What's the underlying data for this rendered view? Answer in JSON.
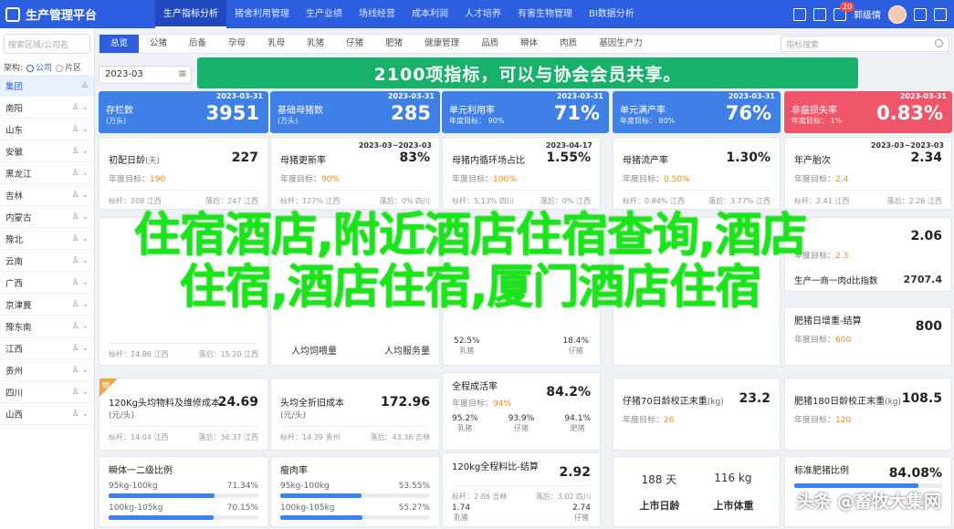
{
  "app": {
    "title": "生产管理平台"
  },
  "topnav": [
    "生产指标分析",
    "猪舍利用管理",
    "生产业绩",
    "场线经营",
    "成本利润",
    "人才培养",
    "有害生物管理",
    "BI数据分析"
  ],
  "topright": {
    "badge": "20",
    "user": "郭级情"
  },
  "sidebar": {
    "search_placeholder": "搜索区域/公司名",
    "scope_label": "架构:",
    "scope_options": [
      "公司",
      "片区"
    ],
    "items": [
      "集团",
      "南阳",
      "山东",
      "安徽",
      "黑龙江",
      "吉林",
      "内蒙古",
      "豫北",
      "云南",
      "广西",
      "京津冀",
      "豫东南",
      "江西",
      "贵州",
      "四川",
      "山西"
    ]
  },
  "tabs": [
    "总览",
    "公猪",
    "后备",
    "孕母",
    "乳母",
    "乳猪",
    "仔猪",
    "肥猪",
    "健康管理",
    "品质",
    "瞬体",
    "肉质",
    "基因生产力"
  ],
  "tab_search_placeholder": "指标搜索",
  "date": "2023-03",
  "banner": "2100项指标，可以与协会会员共享。",
  "kpis": [
    {
      "date": "2023-03-31",
      "name": "存栏数",
      "sub": "(万头)",
      "value": "3951",
      "color": "#3f80e6"
    },
    {
      "date": "2023-03-31",
      "name": "基础母猪数",
      "sub": "(万头)",
      "value": "285",
      "color": "#3f80e6"
    },
    {
      "date": "2023-03-31",
      "name": "单元利用率",
      "sub": "年度目标： 90%",
      "value": "71%",
      "color": "#3f80e6"
    },
    {
      "date": "2023-03-31",
      "name": "单元满产率",
      "sub": "年度目标： 80%",
      "value": "76%",
      "color": "#3f80e6"
    },
    {
      "date": "2023-03-31",
      "name": "非瘟损失率",
      "sub": "年度目标： 1%",
      "value": "0.83%",
      "color": "#f0566a"
    }
  ],
  "cards_row1": [
    {
      "title": "初配日龄",
      "unit": "(天)",
      "date": "",
      "value": "227",
      "goal_label": "年度目标：",
      "goal": "190",
      "f1": "标杆：208 江西",
      "f2": "落后：247 江西"
    },
    {
      "title": "母猪更新率",
      "unit": "",
      "date": "2023-03~2023-03",
      "value": "83%",
      "goal_label": "年度目标：",
      "goal": "90%",
      "f1": "标杆：127% 江西",
      "f2": "落后：0% 四川"
    },
    {
      "title": "母猪内循环场占比",
      "unit": "",
      "date": "2023-04-17",
      "value": "1.55%",
      "goal_label": "年度目标：",
      "goal": "100%",
      "f1": "标杆：5.13% 四川",
      "f2": "落后：0% 江西"
    },
    {
      "title": "母猪流产率",
      "unit": "",
      "date": "",
      "value": "1.30%",
      "goal_label": "年度目标：",
      "goal": "0.50%",
      "f1": "标杆：0.84% 江西",
      "f2": "落后：3.77% 江西"
    },
    {
      "title": "年产胎次",
      "unit": "",
      "date": "2023-03~2023-03",
      "value": "2.34",
      "goal_label": "年度目标：",
      "goal": "2.4",
      "f1": "标杆：2.41 江西",
      "f2": "落后：2.26 江西"
    }
  ],
  "cards_row2_right": [
    {
      "title": "",
      "value": "2.06",
      "goal": "2.3"
    },
    {
      "title": "生产一商一肉d比指数",
      "value": "2707.4"
    }
  ],
  "overlay": [
    "住宿酒店,附近酒店住宿查询,酒店",
    "住宿,酒店住宿,厦门酒店住宿"
  ],
  "mid": {
    "left_foot": [
      "标杆：14.86 江西",
      "落后：15.20 江西"
    ],
    "rate_labels": [
      "人均饲喂量",
      "人均服务量"
    ],
    "center_vals": [
      "52.5%",
      "18.4%"
    ],
    "center_labels": [
      "乳猪",
      "仔猪"
    ],
    "right_title": "肥猪日增重-结算",
    "right_value": "800",
    "right_goal": "600"
  },
  "row3": [
    {
      "title": "120Kg头均物料及维修成本",
      "unit": "(元/头)",
      "value": "24.69",
      "f1": "标杆：14.04 江西",
      "f2": "落后：36.37 江西",
      "corner": "物"
    },
    {
      "title": "头均全折旧成本",
      "unit": "(元/头)",
      "value": "172.96",
      "f1": "标杆：14.39 贵州",
      "f2": "落后：43.36 吉林"
    },
    {
      "title": "全程成活率",
      "value": "84.2%",
      "goal": "94%",
      "subs": [
        [
          "95.2%",
          "乳猪"
        ],
        [
          "93.9%",
          "仔猪"
        ],
        [
          "94.1%",
          "肥猪"
        ]
      ]
    },
    {
      "title": "仔猪70日龄校正末重",
      "unit": "(kg)",
      "value": "23.2",
      "goal": "26"
    },
    {
      "title": "肥猪180日龄校正末重",
      "unit": "(kg)",
      "value": "108.5",
      "goal": "120"
    }
  ],
  "row4": [
    {
      "title": "瞬体一二级比例",
      "bars": [
        [
          "95kg-100kg",
          "71.34%",
          71
        ],
        [
          "100kg-105kg",
          "70.15%",
          70
        ]
      ]
    },
    {
      "title": "瘦肉率",
      "bars": [
        [
          "95kg-100kg",
          "53.55%",
          54
        ],
        [
          "100kg-105kg",
          "55.27%",
          55
        ]
      ]
    },
    {
      "title": "120kg全程料比-结算",
      "value": "2.92",
      "subs": [
        [
          "1.74",
          "乳猪"
        ],
        [
          "2.74",
          "仔猪"
        ]
      ],
      "f1": "标杆：2.86 吉林",
      "f2": "落后：3.02 四川"
    },
    {
      "title": "",
      "cells": [
        [
          "188 天",
          "116 kg"
        ],
        [
          "上市日龄",
          "上市体重"
        ]
      ]
    },
    {
      "title": "标准肥猪比例",
      "value": "84.08%"
    }
  ],
  "watermark": "头条 @畜牧大集网"
}
